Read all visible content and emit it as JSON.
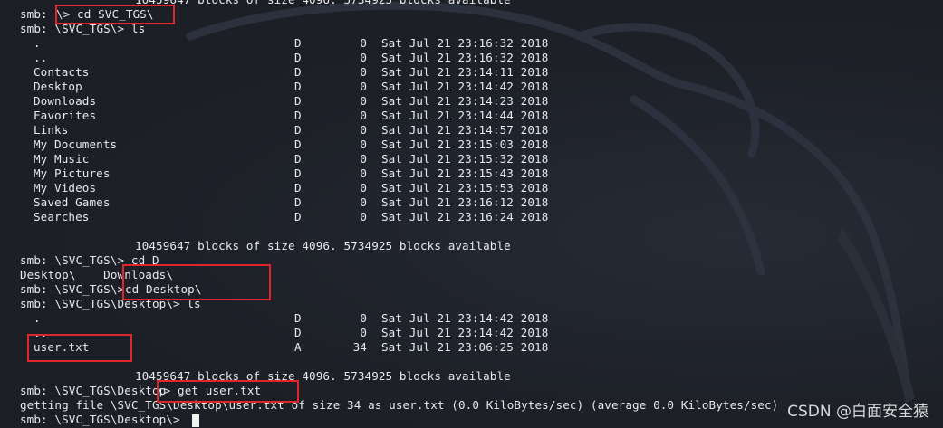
{
  "top_partial": "10459647 blocks of size 4096. 5734925 blocks available",
  "cmd_cd_svc": {
    "prompt": "smb: ",
    "text": "\\> cd SVC_TGS\\"
  },
  "cmd_ls1": "smb: \\SVC_TGS\\> ls",
  "listing1": [
    {
      "name": ".",
      "attr": "D",
      "size": "0",
      "date": "Sat Jul 21 23:16:32 2018"
    },
    {
      "name": "..",
      "attr": "D",
      "size": "0",
      "date": "Sat Jul 21 23:16:32 2018"
    },
    {
      "name": "Contacts",
      "attr": "D",
      "size": "0",
      "date": "Sat Jul 21 23:14:11 2018"
    },
    {
      "name": "Desktop",
      "attr": "D",
      "size": "0",
      "date": "Sat Jul 21 23:14:42 2018"
    },
    {
      "name": "Downloads",
      "attr": "D",
      "size": "0",
      "date": "Sat Jul 21 23:14:23 2018"
    },
    {
      "name": "Favorites",
      "attr": "D",
      "size": "0",
      "date": "Sat Jul 21 23:14:44 2018"
    },
    {
      "name": "Links",
      "attr": "D",
      "size": "0",
      "date": "Sat Jul 21 23:14:57 2018"
    },
    {
      "name": "My Documents",
      "attr": "D",
      "size": "0",
      "date": "Sat Jul 21 23:15:03 2018"
    },
    {
      "name": "My Music",
      "attr": "D",
      "size": "0",
      "date": "Sat Jul 21 23:15:32 2018"
    },
    {
      "name": "My Pictures",
      "attr": "D",
      "size": "0",
      "date": "Sat Jul 21 23:15:43 2018"
    },
    {
      "name": "My Videos",
      "attr": "D",
      "size": "0",
      "date": "Sat Jul 21 23:15:53 2018"
    },
    {
      "name": "Saved Games",
      "attr": "D",
      "size": "0",
      "date": "Sat Jul 21 23:16:12 2018"
    },
    {
      "name": "Searches",
      "attr": "D",
      "size": "0",
      "date": "Sat Jul 21 23:16:24 2018"
    }
  ],
  "blocks1": "10459647 blocks of size 4096. 5734925 blocks available",
  "cmd_cd_d": "smb: \\SVC_TGS\\> cd D",
  "completion": "Desktop\\    Downloads\\",
  "cmd_cd_desktop": {
    "prompt": "smb: \\SVC_TGS\\> ",
    "text": "cd Desktop\\"
  },
  "cmd_ls2": "smb: \\SVC_TGS\\Desktop\\> ls",
  "listing2": [
    {
      "name": ".",
      "attr": "D",
      "size": "0",
      "date": "Sat Jul 21 23:14:42 2018"
    },
    {
      "name": "..",
      "attr": "D",
      "size": "0",
      "date": "Sat Jul 21 23:14:42 2018"
    },
    {
      "name": "user.txt",
      "attr": "A",
      "size": "34",
      "date": "Sat Jul 21 23:06:25 2018"
    }
  ],
  "blocks2": "10459647 blocks of size 4096. 5734925 blocks available",
  "cmd_get": {
    "prompt": "smb: \\SVC_TGS\\Desktop",
    "text": "\\> get user.txt"
  },
  "get_output": "getting file \\SVC_TGS\\Desktop\\user.txt of size 34 as user.txt (0.0 KiloBytes/sec) (average 0.0 KiloBytes/sec)",
  "final_prompt": "smb: \\SVC_TGS\\Desktop\\> ",
  "watermark": "CSDN @白面安全猿",
  "colors": {
    "background": "#1c1f26",
    "text": "#e6e8ec",
    "highlight": "#e0262a"
  }
}
